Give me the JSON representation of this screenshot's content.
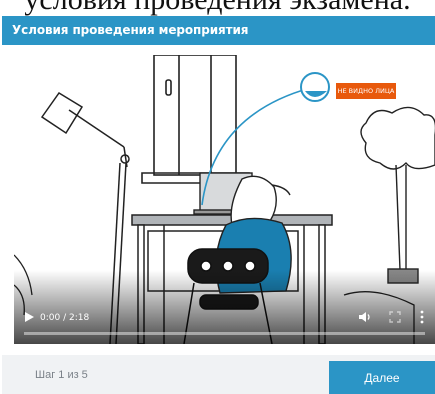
{
  "page": {
    "heading": "условия проведения экзамена."
  },
  "modal": {
    "title": "Условия проведения мероприятия"
  },
  "video": {
    "overlay_label": "НЕ ВИДНО ЛИЦА",
    "current_time": "0:00",
    "duration": "2:18",
    "time_display": "0:00 / 2:18",
    "progress_fraction": 0,
    "icons": {
      "play": "play-icon",
      "volume": "volume-icon",
      "fullscreen": "fullscreen-icon",
      "more": "more-options-icon"
    }
  },
  "footer": {
    "step_text": "Шаг 1 из 5",
    "next_label": "Далее"
  },
  "colors": {
    "accent": "#2b95c6",
    "warning": "#e8590c",
    "footer_bg": "#f0f2f4"
  }
}
